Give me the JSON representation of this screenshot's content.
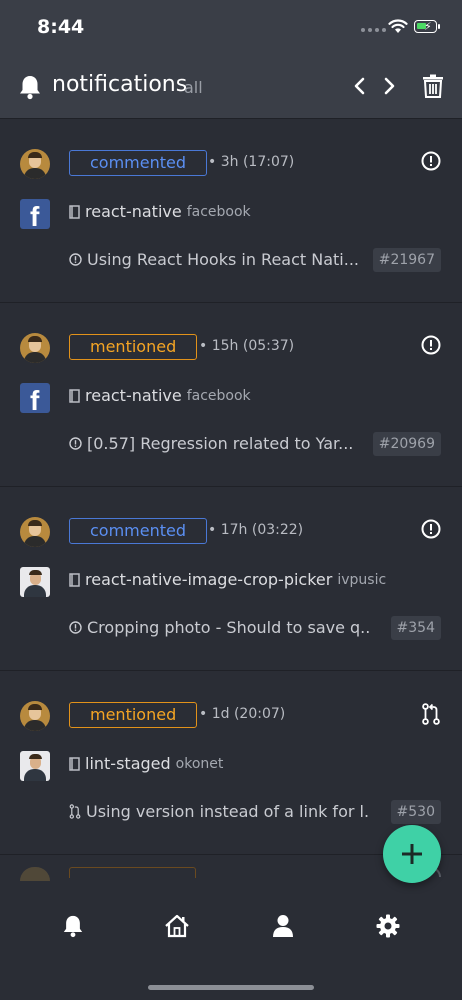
{
  "status_bar": {
    "time": "8:44"
  },
  "header": {
    "title": "notifications",
    "filter": "all"
  },
  "notifications": [
    {
      "reason": "commented",
      "when": "3h (17:07)",
      "type_icon": "issue-icon",
      "repo": "react-native",
      "owner": "facebook",
      "repo_avatar": "facebook-logo",
      "subject": "Using React Hooks in React Nati...",
      "subject_icon": "issue-icon",
      "number": "#21967"
    },
    {
      "reason": "mentioned",
      "when": "15h (05:37)",
      "type_icon": "issue-icon",
      "repo": "react-native",
      "owner": "facebook",
      "repo_avatar": "facebook-logo",
      "subject": "[0.57] Regression related to Yar...",
      "subject_icon": "issue-icon",
      "number": "#20969"
    },
    {
      "reason": "commented",
      "when": "17h (03:22)",
      "type_icon": "issue-icon",
      "repo": "react-native-image-crop-picker",
      "owner": "ivpusic",
      "repo_avatar": "user-photo",
      "subject": "Cropping photo - Should to save q...",
      "subject_icon": "issue-icon",
      "number": "#354"
    },
    {
      "reason": "mentioned",
      "when": "1d (20:07)",
      "type_icon": "pull-request-icon",
      "repo": "lint-staged",
      "owner": "okonet",
      "repo_avatar": "user-photo",
      "subject": "Using version instead of a link for l...",
      "subject_icon": "pull-request-icon",
      "number": "#530"
    }
  ],
  "colors": {
    "commented": "#5b8ff2",
    "mentioned": "#f5a524",
    "fab": "#3fd1a6",
    "background": "#2a2d35",
    "header": "#3a3e47"
  },
  "tabs": [
    {
      "icon": "bell-icon",
      "active": true
    },
    {
      "icon": "home-icon",
      "active": false
    },
    {
      "icon": "user-icon",
      "active": false
    },
    {
      "icon": "gear-icon",
      "active": false
    }
  ],
  "fab": {
    "icon": "plus-icon"
  }
}
